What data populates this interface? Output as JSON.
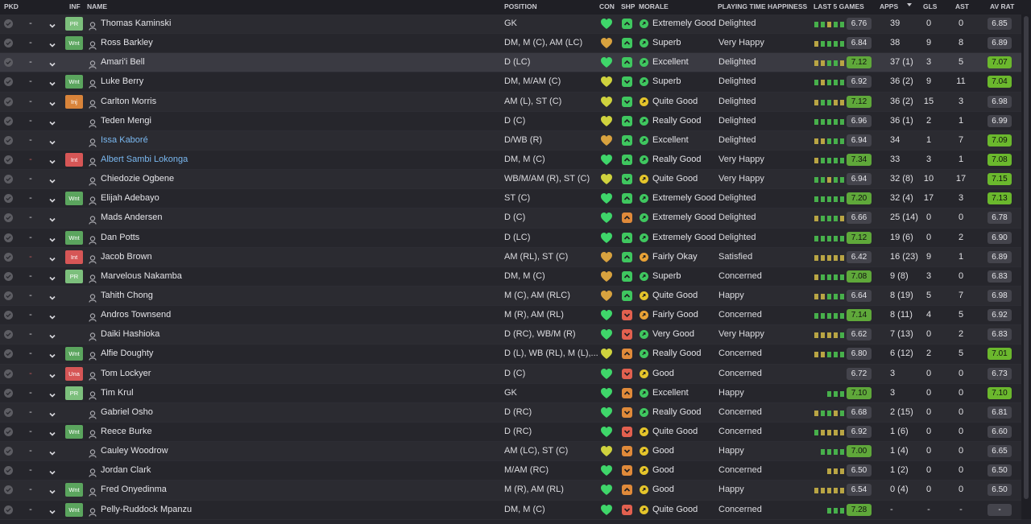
{
  "headers": {
    "pkd": "PKD",
    "inf": "INF",
    "name": "NAME",
    "position": "POSITION",
    "con": "CON",
    "shp": "SHP",
    "morale": "MORALE",
    "pth": "PLAYING TIME HAPPINESS",
    "last5": "LAST 5 GAMES",
    "apps": "APPS",
    "gls": "GLS",
    "ast": "AST",
    "avrat": "AV RAT"
  },
  "sort": {
    "column": "apps",
    "direction": "desc",
    "icon": "sort-down-icon"
  },
  "colors": {
    "green": "#5fa83a",
    "wnt": "#5ba55e",
    "pr": "#7cbf7c",
    "inj": "#d9843a",
    "int": "#d65656",
    "link": "#7ab8f0"
  },
  "players": [
    {
      "name": "Thomas Kaminski",
      "inf": "PR",
      "pos": "GK",
      "con": "green",
      "shp": "green-up",
      "morale": "Extremely Good",
      "mc": "green",
      "pth": "Delighted",
      "form": [
        "g",
        "g",
        "y",
        "g",
        "g"
      ],
      "l5": "6.76",
      "l5g": false,
      "apps": "39",
      "gls": "0",
      "ast": "0",
      "avrat": "6.85",
      "avg": false
    },
    {
      "name": "Ross Barkley",
      "inf": "Wnt",
      "pos": "DM, M (C), AM (LC)",
      "con": "orange",
      "shp": "green-up",
      "morale": "Superb",
      "mc": "green",
      "pth": "Very Happy",
      "form": [
        "y",
        "g",
        "g",
        "g",
        "g"
      ],
      "l5": "6.84",
      "l5g": false,
      "apps": "38",
      "gls": "9",
      "ast": "8",
      "avrat": "6.89",
      "avg": false
    },
    {
      "name": "Amari'i Bell",
      "inf": "",
      "pos": "D (LC)",
      "con": "green",
      "shp": "green-up",
      "morale": "Excellent",
      "mc": "green",
      "pth": "Delighted",
      "form": [
        "y",
        "y",
        "g",
        "g",
        "y"
      ],
      "l5": "7.12",
      "l5g": true,
      "apps": "37 (1)",
      "gls": "3",
      "ast": "5",
      "avrat": "7.07",
      "avg": true,
      "sel": true
    },
    {
      "name": "Luke Berry",
      "inf": "Wnt",
      "pos": "DM, M/AM (C)",
      "con": "yellow",
      "shp": "green-down",
      "morale": "Superb",
      "mc": "green",
      "pth": "Delighted",
      "form": [
        "g",
        "y",
        "g",
        "g",
        "g"
      ],
      "l5": "6.92",
      "l5g": false,
      "apps": "36 (2)",
      "gls": "9",
      "ast": "11",
      "avrat": "7.04",
      "avg": true
    },
    {
      "name": "Carlton Morris",
      "inf": "Inj",
      "pos": "AM (L), ST (C)",
      "con": "yellow",
      "shp": "green-down",
      "morale": "Quite Good",
      "mc": "yellow",
      "pth": "Delighted",
      "form": [
        "y",
        "g",
        "g",
        "y",
        "y"
      ],
      "l5": "7.12",
      "l5g": true,
      "apps": "36 (2)",
      "gls": "15",
      "ast": "3",
      "avrat": "6.98",
      "avg": false
    },
    {
      "name": "Teden Mengi",
      "inf": "",
      "pos": "D (C)",
      "con": "yellow",
      "shp": "green-up",
      "morale": "Really Good",
      "mc": "green",
      "pth": "Delighted",
      "form": [
        "g",
        "g",
        "g",
        "g",
        "g"
      ],
      "l5": "6.96",
      "l5g": false,
      "apps": "36 (1)",
      "gls": "2",
      "ast": "1",
      "avrat": "6.99",
      "avg": false
    },
    {
      "name": "Issa Kaboré",
      "inf": "",
      "pos": "D/WB (R)",
      "con": "orange",
      "shp": "green-up",
      "morale": "Excellent",
      "mc": "green",
      "pth": "Delighted",
      "form": [
        "y",
        "y",
        "g",
        "g",
        "g"
      ],
      "l5": "6.94",
      "l5g": false,
      "apps": "34",
      "gls": "1",
      "ast": "7",
      "avrat": "7.09",
      "avg": true,
      "link": true
    },
    {
      "name": "Albert Sambi Lokonga",
      "inf": "Int",
      "pos": "DM, M (C)",
      "con": "green",
      "shp": "green-up",
      "morale": "Really Good",
      "mc": "green",
      "pth": "Very Happy",
      "form": [
        "y",
        "g",
        "g",
        "g",
        "g"
      ],
      "l5": "7.34",
      "l5g": true,
      "apps": "33",
      "gls": "3",
      "ast": "1",
      "avrat": "7.08",
      "avg": true,
      "link": true,
      "dashred": true
    },
    {
      "name": "Chiedozie Ogbene",
      "inf": "",
      "pos": "WB/M/AM (R), ST (C)",
      "con": "yellow",
      "shp": "green-down",
      "morale": "Quite Good",
      "mc": "yellow",
      "pth": "Very Happy",
      "form": [
        "g",
        "g",
        "y",
        "g",
        "g"
      ],
      "l5": "6.94",
      "l5g": false,
      "apps": "32 (8)",
      "gls": "10",
      "ast": "17",
      "avrat": "7.15",
      "avg": true
    },
    {
      "name": "Elijah Adebayo",
      "inf": "Wnt",
      "pos": "ST (C)",
      "con": "green",
      "shp": "green-up",
      "morale": "Extremely Good",
      "mc": "green",
      "pth": "Delighted",
      "form": [
        "g",
        "g",
        "g",
        "g",
        "g"
      ],
      "l5": "7.20",
      "l5g": true,
      "apps": "32 (4)",
      "gls": "17",
      "ast": "3",
      "avrat": "7.13",
      "avg": true
    },
    {
      "name": "Mads Andersen",
      "inf": "",
      "pos": "D (C)",
      "con": "green",
      "shp": "orange-up",
      "morale": "Extremely Good",
      "mc": "green",
      "pth": "Delighted",
      "form": [
        "y",
        "g",
        "g",
        "g",
        "y"
      ],
      "l5": "6.66",
      "l5g": false,
      "apps": "25 (14)",
      "gls": "0",
      "ast": "0",
      "avrat": "6.78",
      "avg": false
    },
    {
      "name": "Dan Potts",
      "inf": "Wnt",
      "pos": "D (LC)",
      "con": "green",
      "shp": "green-up",
      "morale": "Extremely Good",
      "mc": "green",
      "pth": "Delighted",
      "form": [
        "g",
        "g",
        "g",
        "g",
        "g"
      ],
      "l5": "7.12",
      "l5g": true,
      "apps": "19 (6)",
      "gls": "0",
      "ast": "2",
      "avrat": "6.90",
      "avg": false
    },
    {
      "name": "Jacob Brown",
      "inf": "Int",
      "pos": "AM (RL), ST (C)",
      "con": "orange",
      "shp": "green-up",
      "morale": "Fairly Okay",
      "mc": "orange",
      "pth": "Satisfied",
      "form": [
        "y",
        "y",
        "y",
        "y",
        "y"
      ],
      "l5": "6.42",
      "l5g": false,
      "apps": "16 (23)",
      "gls": "9",
      "ast": "1",
      "avrat": "6.89",
      "avg": false,
      "dashred": true
    },
    {
      "name": "Marvelous Nakamba",
      "inf": "PR",
      "pos": "DM, M (C)",
      "con": "orange",
      "shp": "green-up",
      "morale": "Superb",
      "mc": "green",
      "pth": "Concerned",
      "form": [
        "y",
        "g",
        "g",
        "g",
        "g"
      ],
      "l5": "7.08",
      "l5g": true,
      "apps": "9 (8)",
      "gls": "3",
      "ast": "0",
      "avrat": "6.83",
      "avg": false
    },
    {
      "name": "Tahith Chong",
      "inf": "",
      "pos": "M (C), AM (RLC)",
      "con": "orange",
      "shp": "green-up",
      "morale": "Quite Good",
      "mc": "yellow",
      "pth": "Happy",
      "form": [
        "y",
        "y",
        "g",
        "g",
        "g"
      ],
      "l5": "6.64",
      "l5g": false,
      "apps": "8 (19)",
      "gls": "5",
      "ast": "7",
      "avrat": "6.98",
      "avg": false
    },
    {
      "name": "Andros Townsend",
      "inf": "",
      "pos": "M (R), AM (RL)",
      "con": "green",
      "shp": "red-down",
      "morale": "Fairly Good",
      "mc": "orange",
      "pth": "Concerned",
      "form": [
        "g",
        "g",
        "g",
        "g",
        "g"
      ],
      "l5": "7.14",
      "l5g": true,
      "apps": "8 (11)",
      "gls": "4",
      "ast": "5",
      "avrat": "6.92",
      "avg": false
    },
    {
      "name": "Daiki Hashioka",
      "inf": "",
      "pos": "D (RC), WB/M (R)",
      "con": "green",
      "shp": "red-down",
      "morale": "Very Good",
      "mc": "green",
      "pth": "Very Happy",
      "form": [
        "y",
        "y",
        "y",
        "y",
        "g"
      ],
      "l5": "6.62",
      "l5g": false,
      "apps": "7 (13)",
      "gls": "0",
      "ast": "2",
      "avrat": "6.83",
      "avg": false
    },
    {
      "name": "Alfie Doughty",
      "inf": "Wnt",
      "pos": "D (L), WB (RL), M (L),...",
      "con": "yellow",
      "shp": "orange-up",
      "morale": "Really Good",
      "mc": "green",
      "pth": "Concerned",
      "form": [
        "y",
        "y",
        "g",
        "g",
        "g"
      ],
      "l5": "6.80",
      "l5g": false,
      "apps": "6 (12)",
      "gls": "2",
      "ast": "5",
      "avrat": "7.01",
      "avg": true
    },
    {
      "name": "Tom Lockyer",
      "inf": "Una",
      "pos": "D (C)",
      "con": "green",
      "shp": "red-down",
      "morale": "Good",
      "mc": "yellow",
      "pth": "Concerned",
      "form": [
        "",
        "",
        "",
        "",
        ""
      ],
      "l5": "6.72",
      "l5g": false,
      "apps": "3",
      "gls": "0",
      "ast": "0",
      "avrat": "6.73",
      "avg": false,
      "dashred": true
    },
    {
      "name": "Tim Krul",
      "inf": "PR",
      "pos": "GK",
      "con": "green",
      "shp": "orange-up",
      "morale": "Excellent",
      "mc": "green",
      "pth": "Happy",
      "form": [
        "",
        "",
        "g",
        "g",
        "g"
      ],
      "l5": "7.10",
      "l5g": true,
      "apps": "3",
      "gls": "0",
      "ast": "0",
      "avrat": "7.10",
      "avg": true
    },
    {
      "name": "Gabriel Osho",
      "inf": "",
      "pos": "D (RC)",
      "con": "green",
      "shp": "orange-down",
      "morale": "Really Good",
      "mc": "green",
      "pth": "Concerned",
      "form": [
        "y",
        "g",
        "g",
        "y",
        "g"
      ],
      "l5": "6.68",
      "l5g": false,
      "apps": "2 (15)",
      "gls": "0",
      "ast": "0",
      "avrat": "6.81",
      "avg": false
    },
    {
      "name": "Reece Burke",
      "inf": "Wnt",
      "pos": "D (RC)",
      "con": "green",
      "shp": "red-down",
      "morale": "Quite Good",
      "mc": "yellow",
      "pth": "Concerned",
      "form": [
        "g",
        "y",
        "y",
        "y",
        "y"
      ],
      "l5": "6.92",
      "l5g": false,
      "apps": "1 (6)",
      "gls": "0",
      "ast": "0",
      "avrat": "6.60",
      "avg": false
    },
    {
      "name": "Cauley Woodrow",
      "inf": "",
      "pos": "AM (LC), ST (C)",
      "con": "yellow",
      "shp": "orange-down",
      "morale": "Good",
      "mc": "yellow",
      "pth": "Happy",
      "form": [
        "",
        "g",
        "g",
        "g",
        "g"
      ],
      "l5": "7.00",
      "l5g": true,
      "apps": "1 (4)",
      "gls": "0",
      "ast": "0",
      "avrat": "6.65",
      "avg": false
    },
    {
      "name": "Jordan Clark",
      "inf": "",
      "pos": "M/AM (RC)",
      "con": "green",
      "shp": "orange-down",
      "morale": "Good",
      "mc": "yellow",
      "pth": "Concerned",
      "form": [
        "",
        "",
        "y",
        "y",
        "y"
      ],
      "l5": "6.50",
      "l5g": false,
      "apps": "1 (2)",
      "gls": "0",
      "ast": "0",
      "avrat": "6.50",
      "avg": false
    },
    {
      "name": "Fred Onyedinma",
      "inf": "Wnt",
      "pos": "M (R), AM (RL)",
      "con": "green",
      "shp": "orange-up",
      "morale": "Good",
      "mc": "yellow",
      "pth": "Happy",
      "form": [
        "y",
        "y",
        "y",
        "y",
        "y"
      ],
      "l5": "6.54",
      "l5g": false,
      "apps": "0 (4)",
      "gls": "0",
      "ast": "0",
      "avrat": "6.50",
      "avg": false
    },
    {
      "name": "Pelly-Ruddock Mpanzu",
      "inf": "Wnt",
      "pos": "DM, M (C)",
      "con": "green",
      "shp": "red-down",
      "morale": "Quite Good",
      "mc": "yellow",
      "pth": "Concerned",
      "form": [
        "",
        "",
        "g",
        "g",
        "g"
      ],
      "l5": "7.28",
      "l5g": true,
      "apps": "-",
      "gls": "-",
      "ast": "-",
      "avrat": "-",
      "avg": false
    }
  ]
}
